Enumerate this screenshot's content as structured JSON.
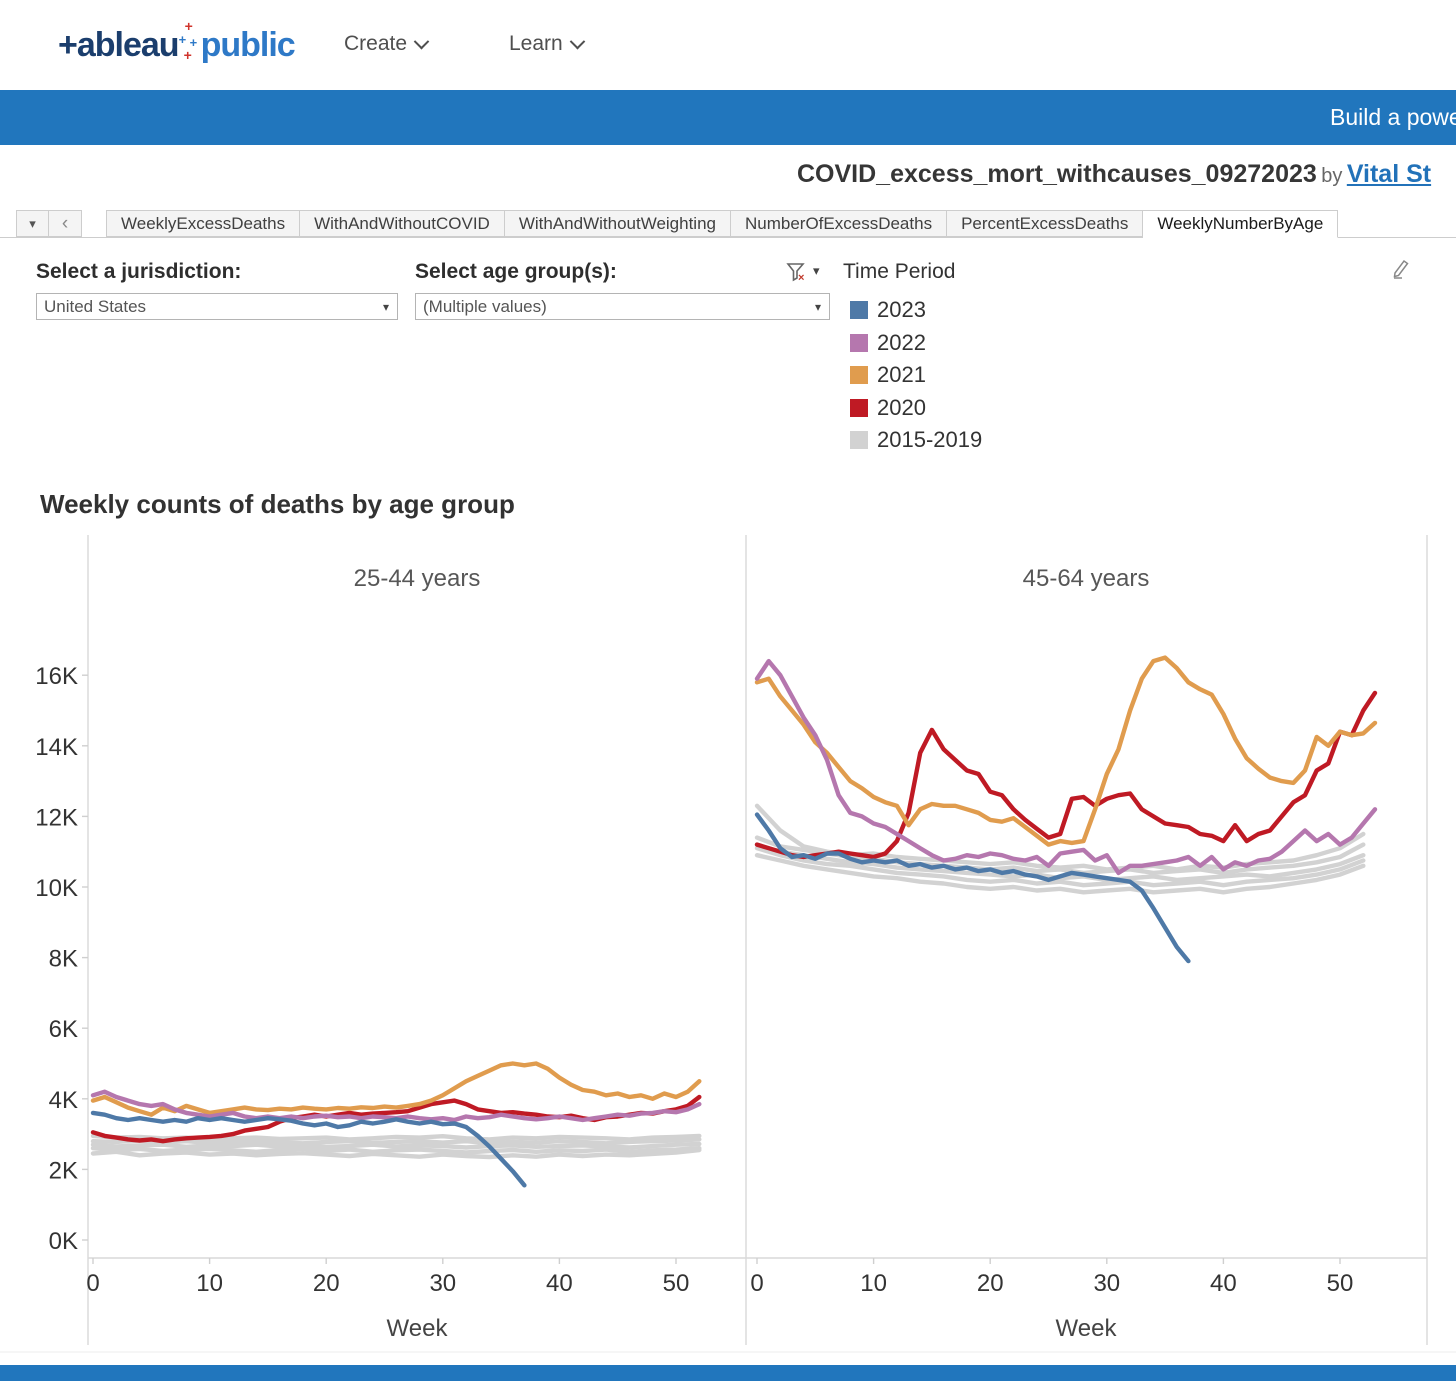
{
  "theme": {
    "banner_blue": "#2176bd",
    "link_blue": "#2272b9"
  },
  "header": {
    "logo_tableau": "+ableau",
    "logo_public": "public",
    "nav": {
      "create": "Create",
      "learn": "Learn"
    }
  },
  "banner": {
    "text": "Build a powe"
  },
  "viz_title": {
    "name": "COVID_excess_mort_withcauses_09272023",
    "by": "by",
    "author": "Vital St"
  },
  "tabbar": {
    "menu_icon": "▾",
    "prev_icon": "‹",
    "items": [
      "WeeklyExcessDeaths",
      "WithAndWithoutCOVID",
      "WithAndWithoutWeighting",
      "NumberOfExcessDeaths",
      "PercentExcessDeaths",
      "WeeklyNumberByAge"
    ],
    "selected_index": 5
  },
  "filters": {
    "jurisdiction_label": "Select a jurisdiction:",
    "jurisdiction_value": "United States",
    "age_label": "Select age group(s):",
    "age_value": "(Multiple values)",
    "caret_icon": "▾"
  },
  "legend": {
    "title": "Time Period",
    "items": [
      {
        "label": "2023",
        "color": "#4e79a7"
      },
      {
        "label": "2022",
        "color": "#b577ae"
      },
      {
        "label": "2021",
        "color": "#e09c4e"
      },
      {
        "label": "2020",
        "color": "#bf1a24"
      },
      {
        "label": "2015-2019",
        "color": "#d2d2d2"
      }
    ]
  },
  "chart_data": {
    "type": "line",
    "title": "Weekly counts of deaths by age group",
    "xlabel": "Week",
    "legend_position": "top-right",
    "grid": false,
    "y_ticks": [
      "0K",
      "2K",
      "4K",
      "6K",
      "8K",
      "10K",
      "12K",
      "14K",
      "16K"
    ],
    "y_tick_values": [
      0,
      2,
      4,
      6,
      8,
      10,
      12,
      14,
      16
    ],
    "x_ticks": [
      0,
      10,
      20,
      30,
      40,
      50
    ],
    "ylim_thousands": [
      0,
      20
    ],
    "xlim_weeks": [
      0,
      56
    ],
    "panels": [
      {
        "title": "25-44 years",
        "series": [
          {
            "name": "2015-2019-a",
            "year": "2015-2019",
            "color": "#d2d2d2",
            "x_step": 2,
            "values": [
              2.95,
              2.9,
              2.92,
              2.88,
              2.9,
              2.85,
              2.88,
              2.9,
              2.86,
              2.88,
              2.9,
              2.85,
              2.88,
              2.92,
              2.9,
              2.94,
              2.88,
              2.85,
              2.9,
              2.88,
              2.92,
              2.9,
              2.88,
              2.85,
              2.9,
              2.92,
              2.95
            ]
          },
          {
            "name": "2015-2019-b",
            "year": "2015-2019",
            "color": "#d2d2d2",
            "x_step": 2,
            "values": [
              2.8,
              2.78,
              2.82,
              2.76,
              2.8,
              2.75,
              2.78,
              2.8,
              2.76,
              2.74,
              2.78,
              2.8,
              2.75,
              2.78,
              2.8,
              2.76,
              2.8,
              2.74,
              2.78,
              2.76,
              2.8,
              2.78,
              2.74,
              2.78,
              2.8,
              2.82,
              2.85
            ]
          },
          {
            "name": "2015-2019-c",
            "year": "2015-2019",
            "color": "#d2d2d2",
            "x_step": 2,
            "values": [
              2.7,
              2.65,
              2.68,
              2.7,
              2.64,
              2.68,
              2.66,
              2.7,
              2.65,
              2.68,
              2.64,
              2.66,
              2.7,
              2.65,
              2.68,
              2.66,
              2.62,
              2.66,
              2.68,
              2.64,
              2.66,
              2.68,
              2.65,
              2.62,
              2.66,
              2.7,
              2.72
            ]
          },
          {
            "name": "2015-2019-d",
            "year": "2015-2019",
            "color": "#d2d2d2",
            "x_step": 2,
            "values": [
              2.6,
              2.55,
              2.58,
              2.52,
              2.56,
              2.58,
              2.54,
              2.5,
              2.55,
              2.58,
              2.52,
              2.56,
              2.5,
              2.54,
              2.56,
              2.52,
              2.48,
              2.52,
              2.55,
              2.5,
              2.54,
              2.52,
              2.56,
              2.5,
              2.54,
              2.56,
              2.6
            ]
          },
          {
            "name": "2015-2019-e",
            "year": "2015-2019",
            "color": "#d2d2d2",
            "x_step": 2,
            "values": [
              2.45,
              2.5,
              2.4,
              2.45,
              2.48,
              2.42,
              2.45,
              2.4,
              2.44,
              2.46,
              2.42,
              2.38,
              2.44,
              2.4,
              2.36,
              2.42,
              2.38,
              2.35,
              2.4,
              2.36,
              2.42,
              2.38,
              2.42,
              2.4,
              2.44,
              2.48,
              2.55
            ]
          },
          {
            "name": "2020",
            "year": "2020",
            "color": "#bf1a24",
            "x_step": 1,
            "values": [
              3.05,
              2.95,
              2.9,
              2.85,
              2.82,
              2.85,
              2.8,
              2.85,
              2.88,
              2.9,
              2.92,
              2.95,
              3.0,
              3.1,
              3.15,
              3.2,
              3.35,
              3.45,
              3.5,
              3.55,
              3.5,
              3.55,
              3.6,
              3.55,
              3.58,
              3.6,
              3.62,
              3.65,
              3.75,
              3.85,
              3.9,
              3.95,
              3.85,
              3.7,
              3.65,
              3.6,
              3.62,
              3.58,
              3.55,
              3.5,
              3.48,
              3.52,
              3.45,
              3.4,
              3.48,
              3.5,
              3.55,
              3.6,
              3.58,
              3.65,
              3.7,
              3.8,
              4.05
            ]
          },
          {
            "name": "2021",
            "year": "2021",
            "color": "#e09c4e",
            "x_step": 1,
            "values": [
              3.95,
              4.05,
              3.9,
              3.75,
              3.65,
              3.55,
              3.75,
              3.65,
              3.8,
              3.7,
              3.6,
              3.65,
              3.7,
              3.75,
              3.7,
              3.68,
              3.72,
              3.7,
              3.75,
              3.72,
              3.7,
              3.74,
              3.72,
              3.76,
              3.74,
              3.78,
              3.75,
              3.8,
              3.85,
              3.95,
              4.1,
              4.3,
              4.5,
              4.65,
              4.8,
              4.95,
              5.0,
              4.95,
              5.0,
              4.85,
              4.6,
              4.4,
              4.25,
              4.2,
              4.1,
              4.15,
              4.05,
              4.1,
              4.0,
              4.15,
              4.05,
              4.2,
              4.5
            ]
          },
          {
            "name": "2022",
            "year": "2022",
            "color": "#b577ae",
            "x_step": 1,
            "values": [
              4.1,
              4.2,
              4.05,
              3.95,
              3.85,
              3.8,
              3.85,
              3.7,
              3.6,
              3.55,
              3.5,
              3.55,
              3.6,
              3.5,
              3.45,
              3.5,
              3.45,
              3.5,
              3.45,
              3.5,
              3.52,
              3.48,
              3.5,
              3.45,
              3.5,
              3.48,
              3.45,
              3.5,
              3.45,
              3.42,
              3.45,
              3.4,
              3.5,
              3.45,
              3.48,
              3.55,
              3.5,
              3.45,
              3.42,
              3.45,
              3.5,
              3.45,
              3.4,
              3.45,
              3.5,
              3.55,
              3.52,
              3.58,
              3.6,
              3.65,
              3.62,
              3.7,
              3.85
            ]
          },
          {
            "name": "2023",
            "year": "2023",
            "color": "#4e79a7",
            "x_step": 1,
            "values": [
              3.6,
              3.55,
              3.45,
              3.4,
              3.45,
              3.4,
              3.35,
              3.4,
              3.35,
              3.45,
              3.4,
              3.45,
              3.4,
              3.35,
              3.4,
              3.45,
              3.42,
              3.38,
              3.3,
              3.25,
              3.3,
              3.2,
              3.25,
              3.35,
              3.3,
              3.35,
              3.42,
              3.35,
              3.3,
              3.35,
              3.28,
              3.3,
              3.2,
              2.95,
              2.65,
              2.3,
              1.95,
              1.55
            ]
          }
        ]
      },
      {
        "title": "45-64 years",
        "series": [
          {
            "name": "2015-2019-a",
            "year": "2015-2019",
            "color": "#d2d2d2",
            "x_step": 2,
            "values": [
              12.3,
              11.6,
              11.15,
              11.0,
              10.9,
              10.95,
              10.85,
              10.8,
              10.75,
              10.7,
              10.65,
              10.7,
              10.6,
              10.55,
              10.6,
              10.5,
              10.55,
              10.6,
              10.5,
              10.6,
              10.55,
              10.65,
              10.7,
              10.75,
              10.9,
              11.1,
              11.5
            ]
          },
          {
            "name": "2015-2019-b",
            "year": "2015-2019",
            "color": "#d2d2d2",
            "x_step": 2,
            "values": [
              11.4,
              11.15,
              11.05,
              10.95,
              10.85,
              10.8,
              10.7,
              10.65,
              10.6,
              10.55,
              10.5,
              10.55,
              10.45,
              10.5,
              10.4,
              10.45,
              10.5,
              10.4,
              10.45,
              10.5,
              10.4,
              10.5,
              10.55,
              10.6,
              10.7,
              10.85,
              11.2
            ]
          },
          {
            "name": "2015-2019-c",
            "year": "2015-2019",
            "color": "#d2d2d2",
            "x_step": 2,
            "values": [
              11.2,
              11.0,
              10.9,
              10.8,
              10.7,
              10.65,
              10.55,
              10.5,
              10.45,
              10.4,
              10.35,
              10.3,
              10.35,
              10.25,
              10.3,
              10.2,
              10.25,
              10.3,
              10.2,
              10.25,
              10.3,
              10.35,
              10.3,
              10.4,
              10.5,
              10.65,
              10.9
            ]
          },
          {
            "name": "2015-2019-d",
            "year": "2015-2019",
            "color": "#d2d2d2",
            "x_step": 2,
            "values": [
              11.1,
              10.9,
              10.75,
              10.65,
              10.6,
              10.5,
              10.4,
              10.35,
              10.3,
              10.2,
              10.15,
              10.2,
              10.1,
              10.15,
              10.05,
              10.1,
              10.15,
              10.05,
              10.1,
              10.15,
              10.05,
              10.15,
              10.2,
              10.25,
              10.35,
              10.5,
              10.75
            ]
          },
          {
            "name": "2015-2019-e",
            "year": "2015-2019",
            "color": "#d2d2d2",
            "x_step": 2,
            "values": [
              10.9,
              10.75,
              10.6,
              10.5,
              10.4,
              10.3,
              10.25,
              10.15,
              10.1,
              10.0,
              9.95,
              10.0,
              9.9,
              9.95,
              9.85,
              9.9,
              9.95,
              9.85,
              9.9,
              9.95,
              9.85,
              9.95,
              10.0,
              10.1,
              10.2,
              10.35,
              10.6
            ]
          },
          {
            "name": "2020",
            "year": "2020",
            "color": "#bf1a24",
            "x_step": 1,
            "values": [
              11.2,
              11.1,
              11.0,
              10.9,
              10.85,
              10.9,
              10.95,
              11.0,
              10.95,
              10.9,
              10.85,
              10.95,
              11.3,
              12.1,
              13.8,
              14.45,
              13.9,
              13.6,
              13.3,
              13.2,
              12.7,
              12.6,
              12.2,
              11.9,
              11.65,
              11.4,
              11.5,
              12.5,
              12.55,
              12.3,
              12.5,
              12.6,
              12.65,
              12.2,
              12.0,
              11.8,
              11.75,
              11.7,
              11.5,
              11.45,
              11.3,
              11.75,
              11.3,
              11.5,
              11.6,
              12.0,
              12.4,
              12.6,
              13.3,
              13.5,
              14.4,
              14.3,
              15.0,
              15.5
            ]
          },
          {
            "name": "2021",
            "year": "2021",
            "color": "#e09c4e",
            "x_step": 1,
            "values": [
              15.8,
              15.9,
              15.4,
              15.0,
              14.6,
              14.1,
              13.8,
              13.4,
              13.0,
              12.8,
              12.55,
              12.4,
              12.3,
              11.75,
              12.2,
              12.35,
              12.3,
              12.3,
              12.2,
              12.1,
              11.9,
              11.85,
              11.95,
              11.7,
              11.45,
              11.2,
              11.3,
              11.25,
              11.3,
              12.2,
              13.2,
              13.9,
              15.0,
              15.9,
              16.4,
              16.5,
              16.2,
              15.8,
              15.6,
              15.45,
              14.9,
              14.2,
              13.65,
              13.35,
              13.1,
              13.0,
              12.95,
              13.3,
              14.25,
              14.0,
              14.4,
              14.3,
              14.35,
              14.65
            ]
          },
          {
            "name": "2022",
            "year": "2022",
            "color": "#b577ae",
            "x_step": 1,
            "values": [
              15.9,
              16.4,
              16.0,
              15.4,
              14.8,
              14.3,
              13.6,
              12.6,
              12.1,
              12.0,
              11.8,
              11.7,
              11.5,
              11.3,
              11.1,
              10.9,
              10.75,
              10.8,
              10.9,
              10.85,
              10.95,
              10.9,
              10.8,
              10.75,
              10.85,
              10.6,
              10.95,
              11.0,
              11.05,
              10.75,
              10.9,
              10.4,
              10.6,
              10.6,
              10.65,
              10.7,
              10.75,
              10.85,
              10.6,
              10.85,
              10.5,
              10.7,
              10.6,
              10.75,
              10.8,
              11.0,
              11.3,
              11.6,
              11.3,
              11.5,
              11.2,
              11.4,
              11.8,
              12.2
            ]
          },
          {
            "name": "2023",
            "year": "2023",
            "color": "#4e79a7",
            "x_step": 1,
            "values": [
              12.05,
              11.6,
              11.1,
              10.85,
              10.9,
              10.8,
              10.95,
              10.95,
              10.8,
              10.7,
              10.75,
              10.7,
              10.75,
              10.6,
              10.65,
              10.55,
              10.6,
              10.5,
              10.55,
              10.45,
              10.5,
              10.4,
              10.45,
              10.35,
              10.3,
              10.2,
              10.3,
              10.4,
              10.35,
              10.3,
              10.25,
              10.2,
              10.15,
              9.9,
              9.4,
              8.85,
              8.3,
              7.9
            ]
          }
        ]
      }
    ]
  }
}
